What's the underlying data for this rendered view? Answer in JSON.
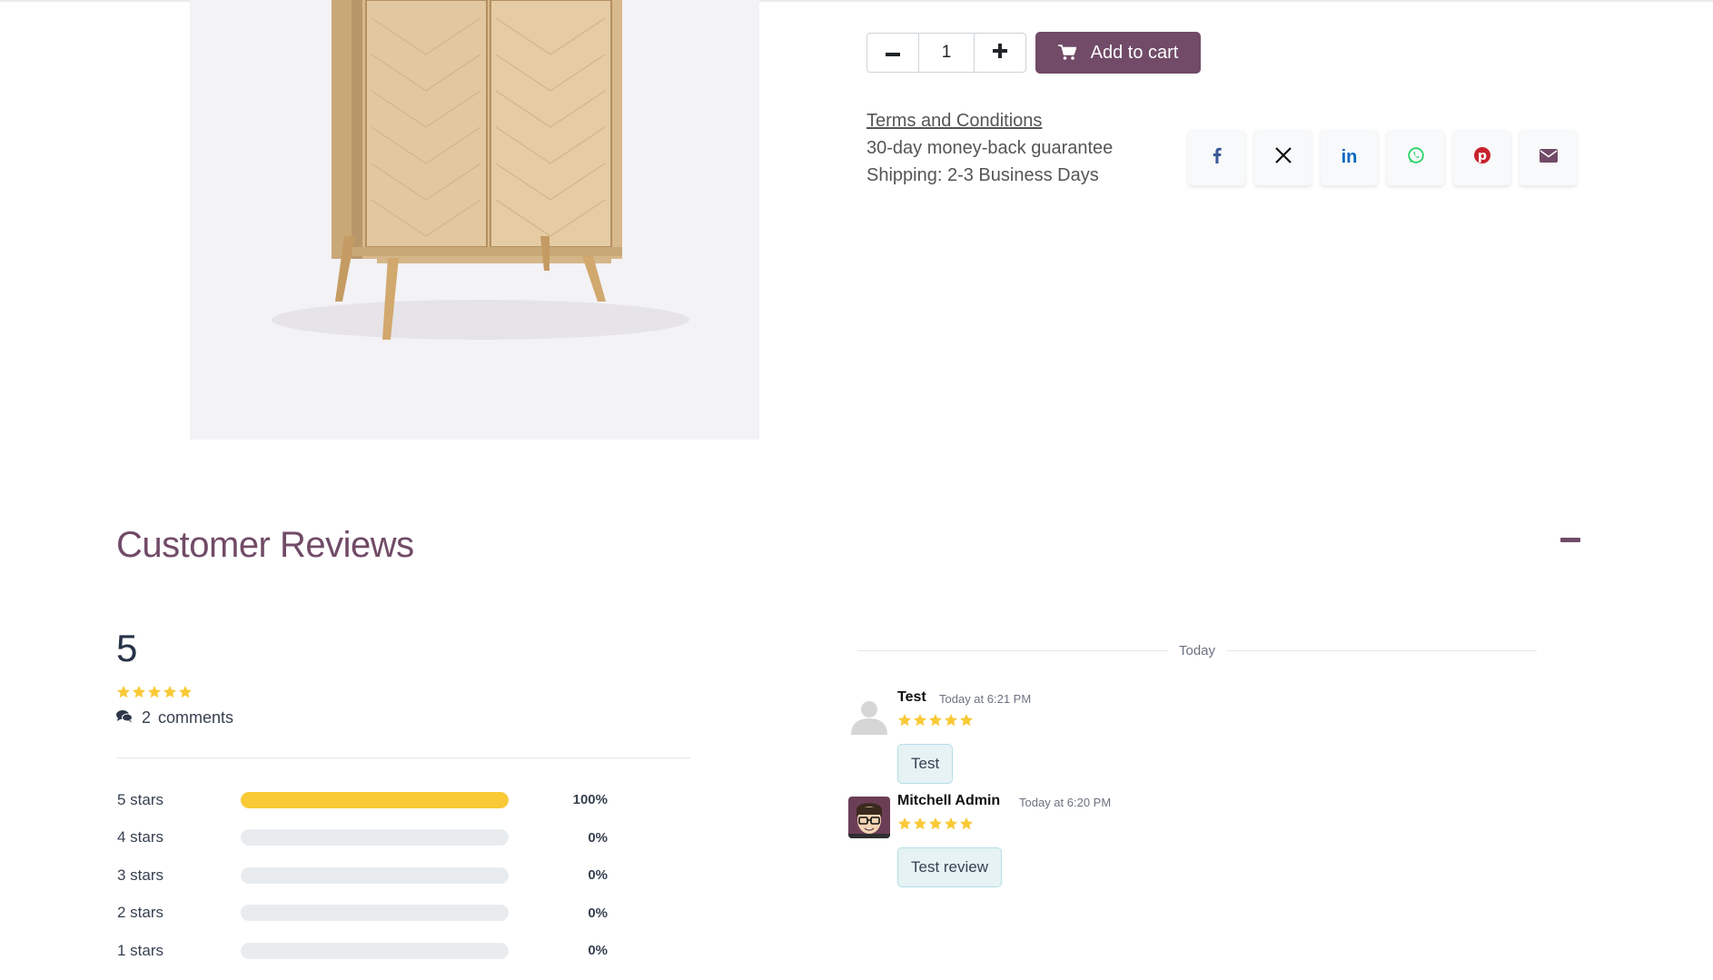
{
  "product": {
    "image_alt_icon": "cabinet-image"
  },
  "purchase": {
    "quantity": "1",
    "decrease_icon": "minus-icon",
    "increase_icon": "plus-icon",
    "add_to_cart_label": "Add to cart",
    "cart_icon": "cart-icon"
  },
  "terms": {
    "link_label": "Terms and Conditions",
    "guarantee": "30-day money-back guarantee",
    "shipping": "Shipping: 2-3 Business Days"
  },
  "share": {
    "icons": [
      "facebook-icon",
      "x-icon",
      "linkedin-icon",
      "whatsapp-icon",
      "pinterest-icon",
      "email-icon"
    ],
    "colors": {
      "facebook": "#3b5998",
      "x": "#111111",
      "linkedin": "#0a66c2",
      "whatsapp": "#25d366",
      "pinterest": "#c8232c",
      "email": "#714b67"
    }
  },
  "reviews": {
    "title": "Customer Reviews",
    "average": "5",
    "average_stars": 5,
    "comment_count": "2",
    "comments_label": "comments",
    "distribution": [
      {
        "label": "5 stars",
        "percent_text": "100%",
        "percent": 100
      },
      {
        "label": "4 stars",
        "percent_text": "0%",
        "percent": 0
      },
      {
        "label": "3 stars",
        "percent_text": "0%",
        "percent": 0
      },
      {
        "label": "2 stars",
        "percent_text": "0%",
        "percent": 0
      },
      {
        "label": "1 stars",
        "percent_text": "0%",
        "percent": 0
      }
    ],
    "date_separator": "Today",
    "comments": [
      {
        "author": "Test",
        "time": "Today at 6:21 PM",
        "stars": 5,
        "body": "Test",
        "avatar": "default-avatar"
      },
      {
        "author": "Mitchell Admin",
        "time": "Today at 6:20 PM",
        "stars": 5,
        "body": "Test review",
        "avatar": "mitchell-avatar"
      }
    ]
  },
  "colors": {
    "brand": "#714b67",
    "star": "#f9c936",
    "bar_track": "#e9ecef",
    "bubble_bg": "#e6f2f4"
  }
}
